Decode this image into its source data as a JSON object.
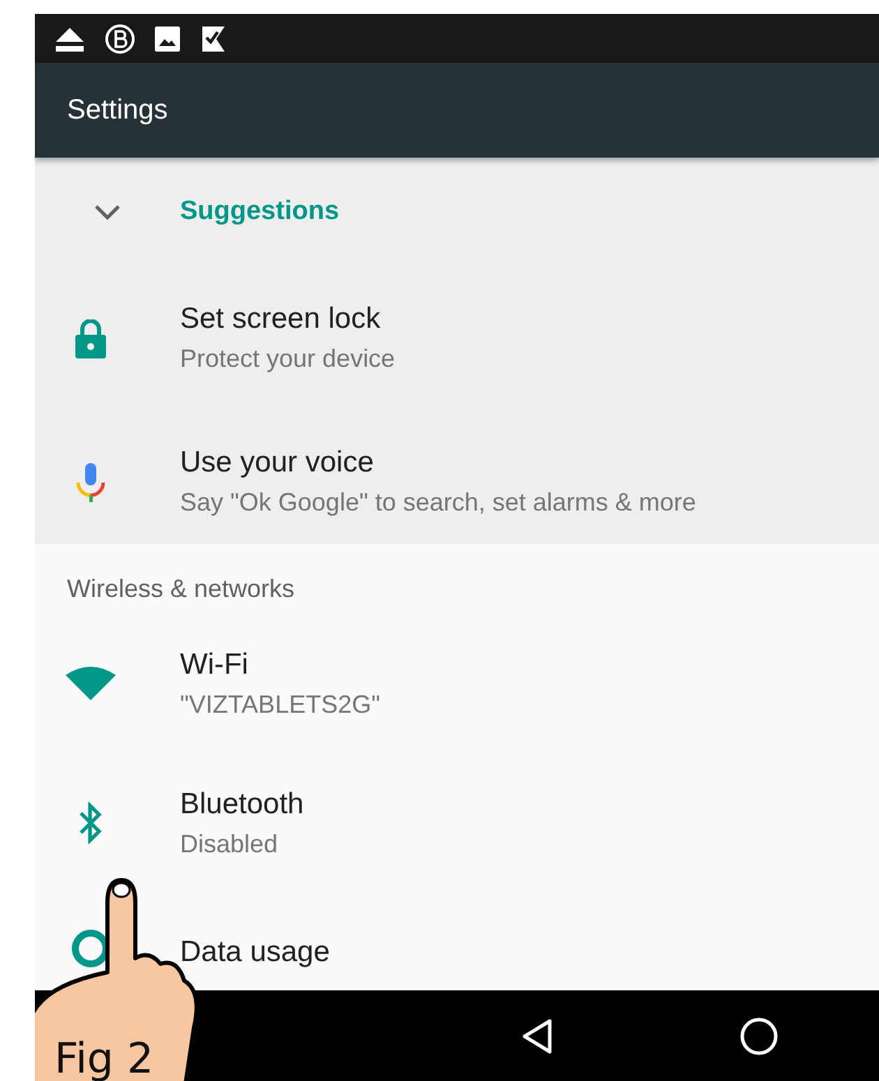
{
  "toolbar": {
    "title": "Settings"
  },
  "suggestions": {
    "title": "Suggestions",
    "expanded": true,
    "items": [
      {
        "kind": "lock",
        "title": "Set screen lock",
        "subtitle": "Protect your device"
      },
      {
        "kind": "mic",
        "title": "Use your voice",
        "subtitle": "Say \"Ok Google\" to search, set alarms & more"
      }
    ]
  },
  "sections": [
    {
      "title": "Wireless & networks",
      "items": [
        {
          "kind": "wifi",
          "title": "Wi-Fi",
          "subtitle": "\"VIZTABLETS2G\""
        },
        {
          "kind": "bluetooth",
          "title": "Bluetooth",
          "subtitle": "Disabled"
        },
        {
          "kind": "data",
          "title": "Data usage"
        }
      ]
    }
  ],
  "caption": "Fig 2"
}
